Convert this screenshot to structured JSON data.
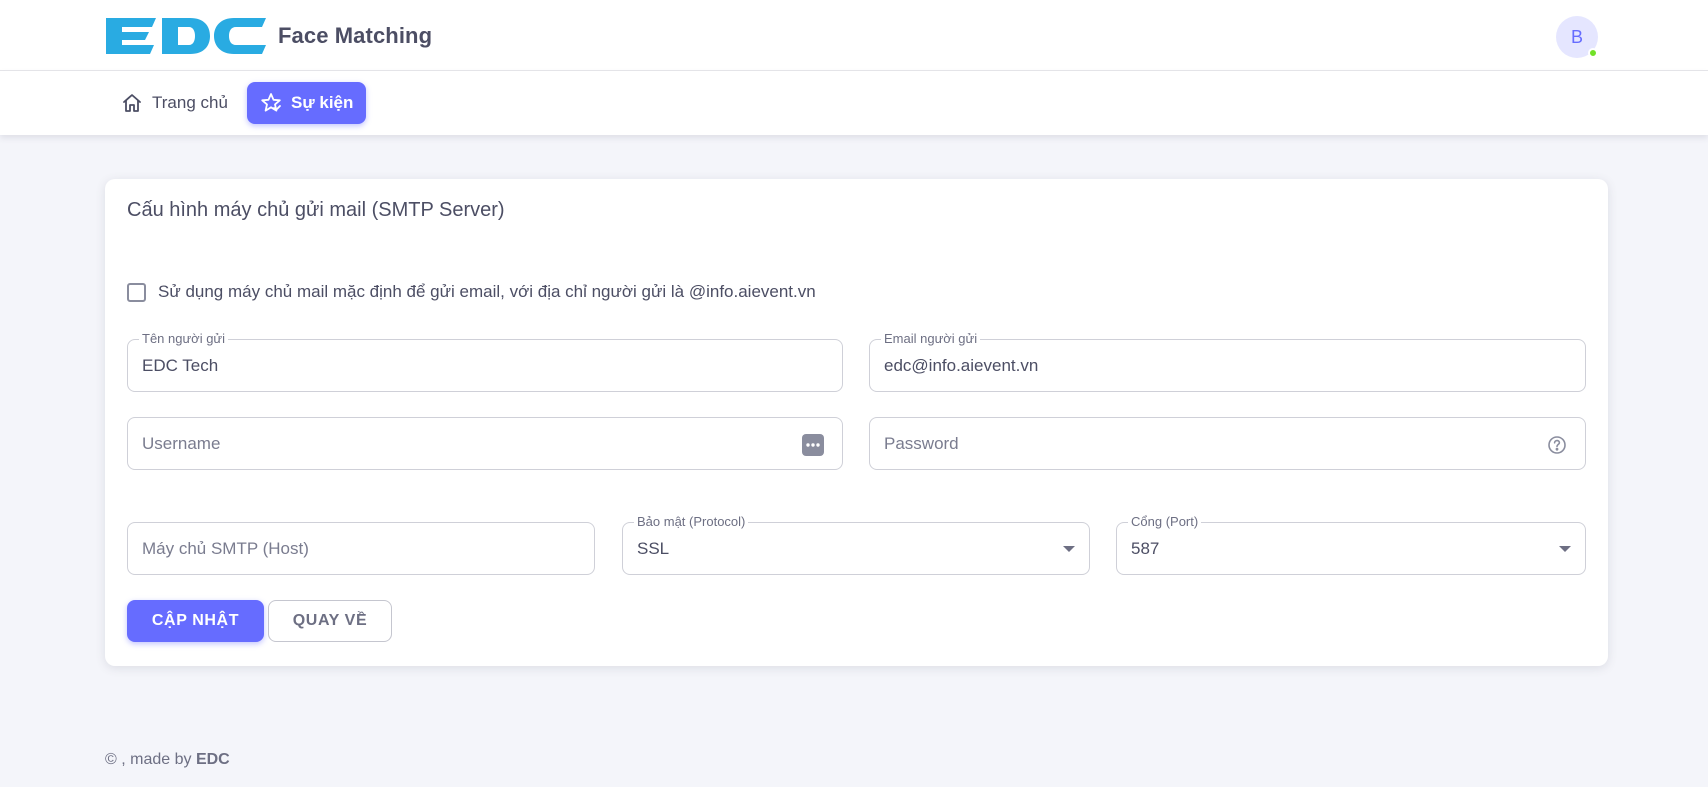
{
  "header": {
    "brand_logo_text": "EDC",
    "app_name": "Face Matching",
    "avatar_initial": "B",
    "colors": {
      "brand": "#29abe2",
      "accent": "#666cff",
      "online": "#72e128"
    }
  },
  "nav": {
    "items": [
      {
        "label": "Trang chủ",
        "icon": "home-icon",
        "active": false
      },
      {
        "label": "Sự kiện",
        "icon": "star-icon",
        "active": true
      }
    ]
  },
  "smtp_form": {
    "title": "Cấu hình máy chủ gửi mail (SMTP Server)",
    "use_default_checkbox": {
      "label": "Sử dụng máy chủ mail mặc định để gửi email, với địa chỉ người gửi là @info.aievent.vn",
      "checked": false
    },
    "sender_name": {
      "label": "Tên người gửi",
      "value": "EDC Tech"
    },
    "sender_email": {
      "label": "Email người gửi",
      "value": "edc@info.aievent.vn"
    },
    "username": {
      "placeholder": "Username",
      "icon": "password-dots-icon"
    },
    "password": {
      "placeholder": "Password",
      "icon": "help-circle-icon"
    },
    "host": {
      "placeholder": "Máy chủ SMTP (Host)"
    },
    "protocol": {
      "label": "Bảo mật (Protocol)",
      "value": "SSL"
    },
    "port": {
      "label": "Cổng (Port)",
      "value": "587"
    },
    "update_button": "CẬP NHẬT",
    "back_button": "QUAY VỀ"
  },
  "footer": {
    "copyright": "© , made by",
    "maker": "EDC"
  }
}
